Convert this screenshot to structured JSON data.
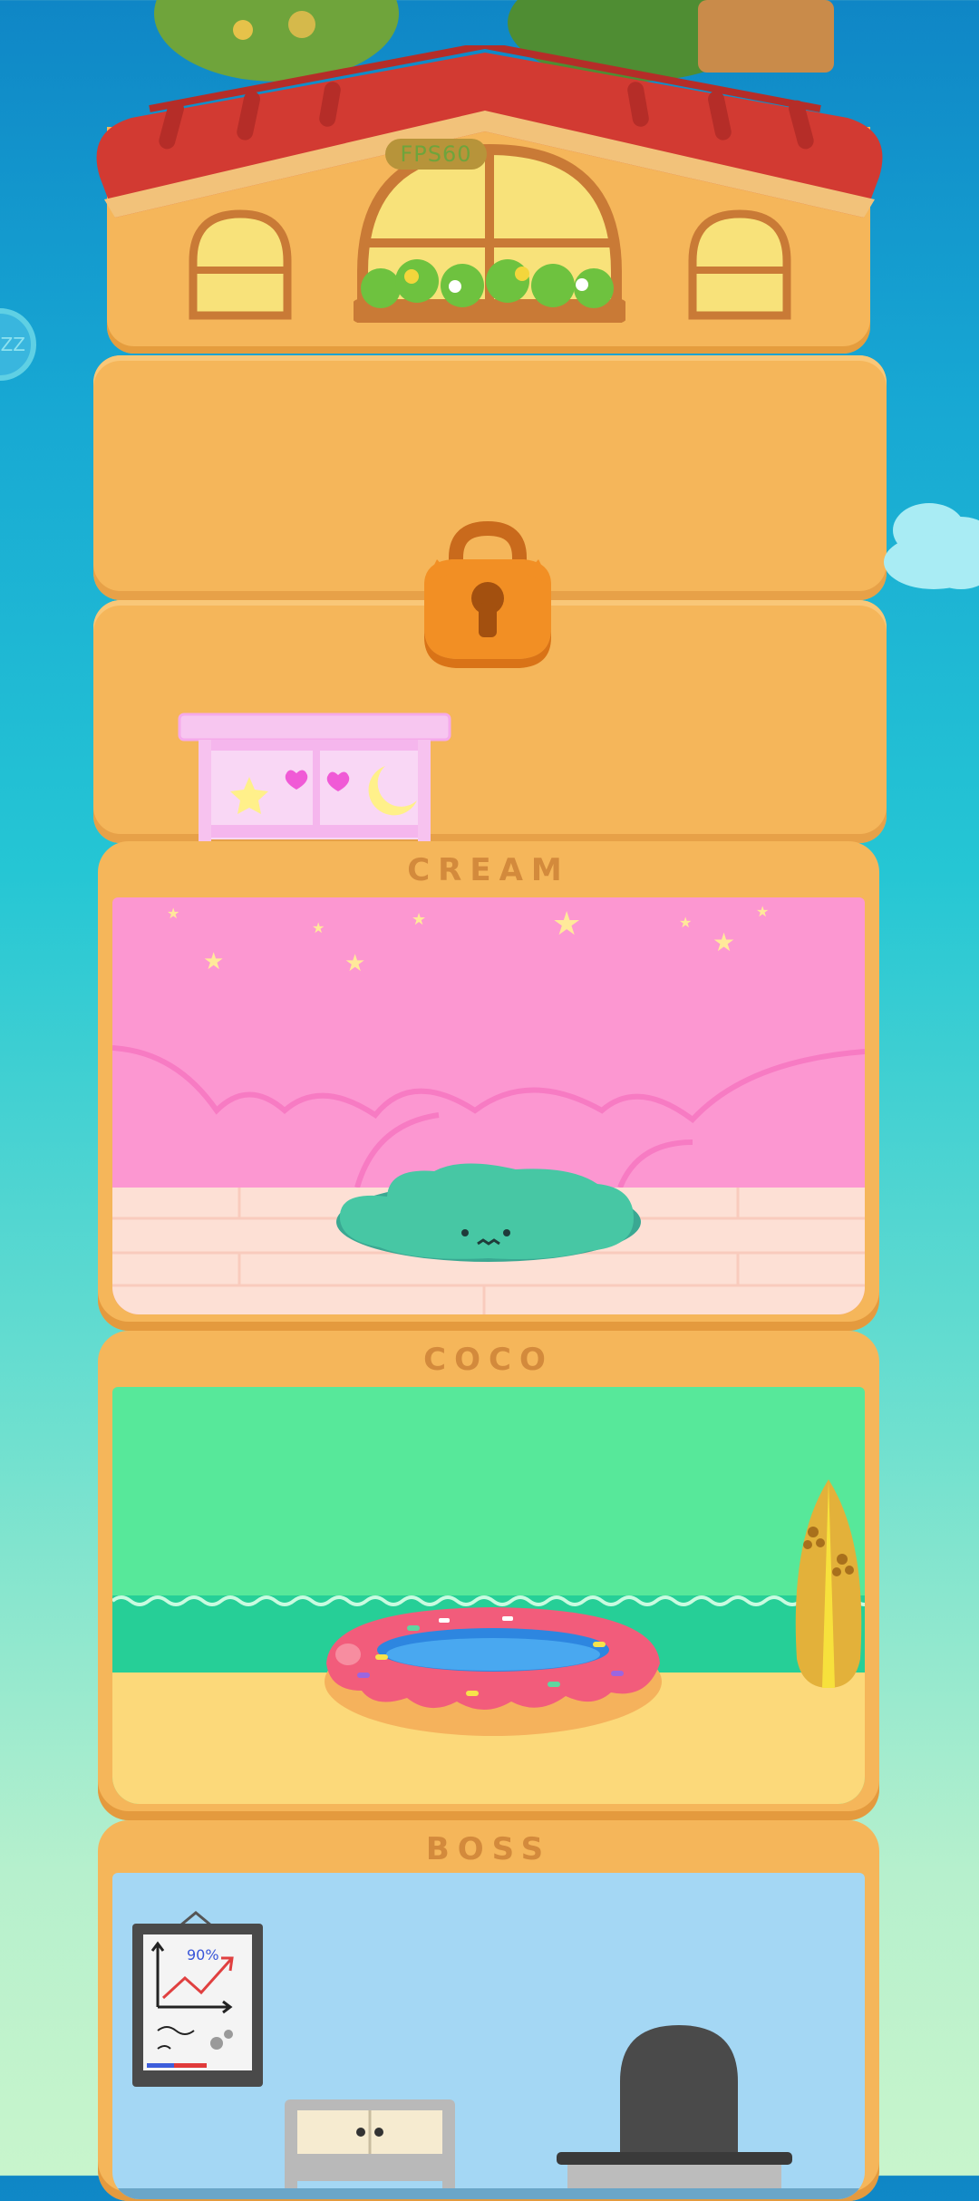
{
  "hud": {
    "fps_label": "FPS60",
    "sleep_button_label": "ZZ"
  },
  "rooms": [
    {
      "name": "CREAM"
    },
    {
      "name": "COCO"
    },
    {
      "name": "BOSS"
    }
  ],
  "whiteboard": {
    "text": "90%"
  },
  "colors": {
    "sky_top": "#0f86c6",
    "sky_bottom": "#c8f5cc",
    "house": "#f5b65a",
    "roof": "#d23a32",
    "room_label": "#d38a3c"
  }
}
